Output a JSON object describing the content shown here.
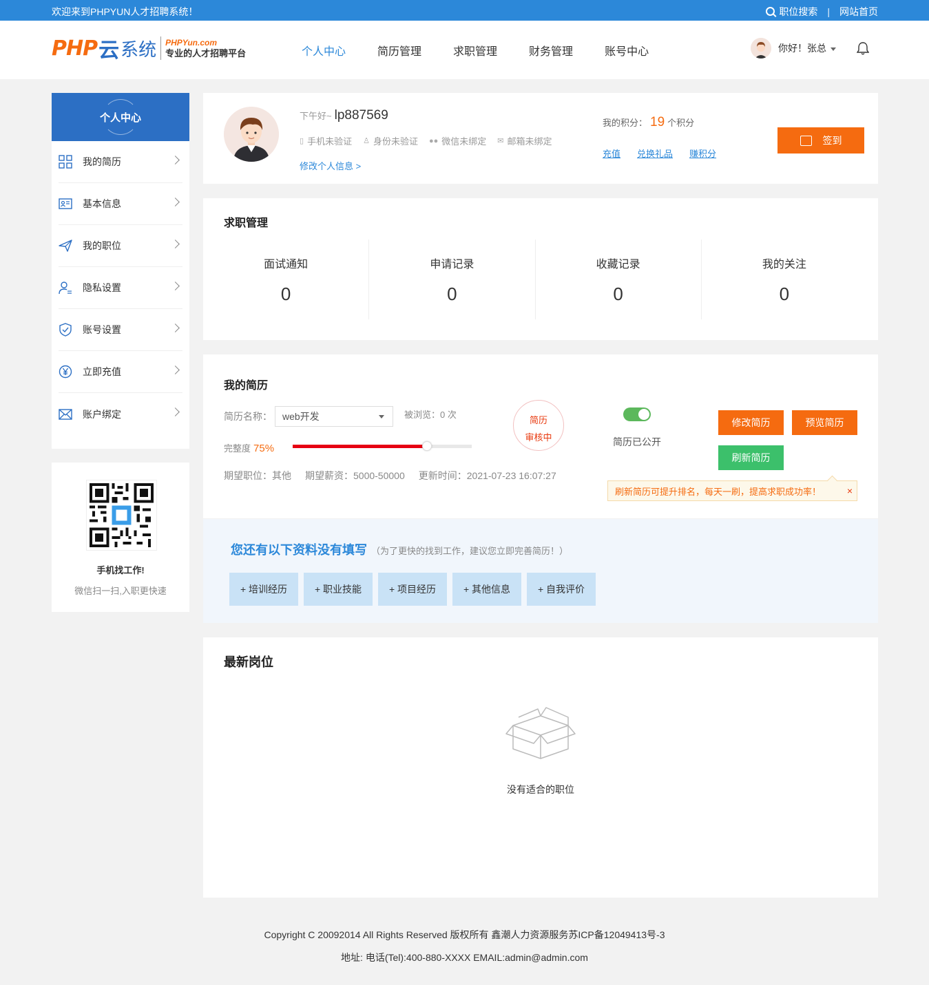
{
  "topbar": {
    "welcome": "欢迎来到PHPYUN人才招聘系统！",
    "job_search": "职位搜索",
    "separator": "|",
    "home": "网站首页"
  },
  "logo": {
    "php": "PHP",
    "yun": "云",
    "system": "系统",
    "domain": "PHPYun.com",
    "slogan": "专业的人才招聘平台"
  },
  "nav": {
    "items": [
      {
        "label": "个人中心",
        "active": true
      },
      {
        "label": "简历管理",
        "active": false
      },
      {
        "label": "求职管理",
        "active": false
      },
      {
        "label": "财务管理",
        "active": false
      },
      {
        "label": "账号中心",
        "active": false
      }
    ]
  },
  "user": {
    "greeting": "你好！张总"
  },
  "sidebar": {
    "title": "个人中心",
    "items": [
      {
        "label": "我的简历",
        "icon": "grid-icon"
      },
      {
        "label": "基本信息",
        "icon": "id-card-icon"
      },
      {
        "label": "我的职位",
        "icon": "send-icon"
      },
      {
        "label": "隐私设置",
        "icon": "user-lock-icon"
      },
      {
        "label": "账号设置",
        "icon": "shield-icon"
      },
      {
        "label": "立即充值",
        "icon": "yen-icon"
      },
      {
        "label": "账户绑定",
        "icon": "mail-icon"
      }
    ]
  },
  "qr": {
    "title": "手机找工作!",
    "subtitle": "微信扫一扫,入职更快速"
  },
  "profile": {
    "greeting_prefix": "下午好~",
    "username": "lp887569",
    "verifications": [
      {
        "label": "手机未验证",
        "icon": "phone-icon"
      },
      {
        "label": "身份未验证",
        "icon": "id-icon"
      },
      {
        "label": "微信未绑定",
        "icon": "wechat-icon"
      },
      {
        "label": "邮箱未绑定",
        "icon": "mail-icon"
      }
    ],
    "edit_link": "修改个人信息 >",
    "points_label": "我的积分：",
    "points_value": "19",
    "points_unit": "个积分",
    "point_links": [
      "充值",
      "兑换礼品",
      "赚积分"
    ],
    "checkin": "签到"
  },
  "job_management": {
    "title": "求职管理",
    "stats": [
      {
        "label": "面试通知",
        "value": "0"
      },
      {
        "label": "申请记录",
        "value": "0"
      },
      {
        "label": "收藏记录",
        "value": "0"
      },
      {
        "label": "我的关注",
        "value": "0"
      }
    ]
  },
  "resume": {
    "title": "我的简历",
    "name_label": "简历名称：",
    "name_value": "web开发",
    "views": "被浏览：0 次",
    "complete_label": "完整度",
    "complete_pct": "75%",
    "complete_value": 0.75,
    "expected_position": "期望职位：其他",
    "expected_salary": "期望薪资：5000-50000",
    "updated": "更新时间：2021-07-23 16:07:27",
    "audit_line1": "简历",
    "audit_line2": "审核中",
    "public_label": "简历已公开",
    "public_on": true,
    "edit_btn": "修改简历",
    "preview_btn": "预览简历",
    "refresh_btn": "刷新简历",
    "tip": "刷新简历可提升排名，每天一刷，提高求职成功率！",
    "tip_close": "×"
  },
  "incomplete": {
    "title": "您还有以下资料没有填写",
    "hint": "（为了更快的找到工作，建议您立即完善简历！）",
    "buttons": [
      "+ 培训经历",
      "+ 职业技能",
      "+ 项目经历",
      "+ 其他信息",
      "+ 自我评价"
    ]
  },
  "latest": {
    "title": "最新岗位",
    "empty": "没有适合的职位"
  },
  "footer": {
    "line1": "Copyright C 20092014 All Rights Reserved 版权所有 鑫潮人力资源服务苏ICP备12049413号-3",
    "line2": "地址: 电话(Tel):400-880-XXXX EMAIL:admin@admin.com"
  },
  "colors": {
    "primary": "#2c88d9",
    "brand_dark": "#2c6fc4",
    "orange": "#f56b10",
    "green": "#3cc06b",
    "red": "#e60012"
  }
}
